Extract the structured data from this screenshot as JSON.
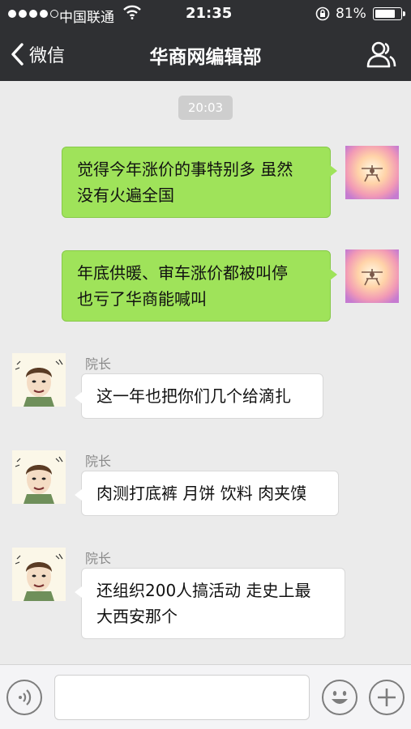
{
  "status_bar": {
    "carrier": "中国联通",
    "time": "21:35",
    "battery_percent": "81%",
    "signal_bars_filled": 4,
    "signal_bars_total": 5,
    "battery_level": 0.81
  },
  "nav": {
    "back_label": "微信",
    "title": "华商网编辑部",
    "back_icon": "chevron-left-icon",
    "profile_icon": "group-profile-icon"
  },
  "chat": {
    "timestamp": "20:03",
    "messages": [
      {
        "side": "mine",
        "text_lines": [
          "觉得今年涨价的事特别多 虽然",
          "没有火遍全国"
        ]
      },
      {
        "side": "mine",
        "text_lines": [
          "年底供暖、审车涨价都被叫停",
          "也亏了华商能喊叫"
        ]
      },
      {
        "side": "theirs",
        "sender": "院长",
        "text_lines": [
          "这一年也把你们几个给滴扎"
        ]
      },
      {
        "side": "theirs",
        "sender": "院长",
        "text_lines": [
          "肉测打底裤 月饼 饮料 肉夹馍"
        ]
      },
      {
        "side": "theirs",
        "sender": "院长",
        "text_lines": [
          "还组织200人搞活动 走史上最",
          "大西安那个"
        ]
      }
    ]
  },
  "input_bar": {
    "voice_icon": "voice-icon",
    "emoji_icon": "emoji-icon",
    "plus_icon": "plus-icon",
    "text_value": ""
  },
  "colors": {
    "bar_bg": "#2f3033",
    "chat_bg": "#ebebeb",
    "my_bubble": "#9fe35a",
    "their_bubble": "#ffffff"
  }
}
